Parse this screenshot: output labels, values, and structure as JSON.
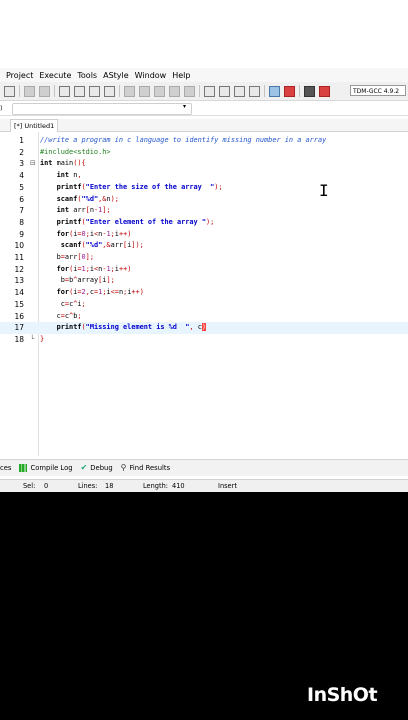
{
  "menu": {
    "items": [
      "Project",
      "Execute",
      "Tools",
      "AStyle",
      "Window",
      "Help"
    ]
  },
  "toolbar": {
    "compiler": "TDM-GCC 4.9.2"
  },
  "tab": {
    "title": "[*] Untitled1"
  },
  "editor": {
    "lines": [
      {
        "n": "1",
        "code": "//write a program in c language to identify missing number in a array"
      },
      {
        "n": "2",
        "code": "#include<stdio.h>"
      },
      {
        "n": "3",
        "code": "int main(){"
      },
      {
        "n": "4",
        "code": "    int n,"
      },
      {
        "n": "5",
        "code": "    printf(\"Enter the size of the array  \");"
      },
      {
        "n": "6",
        "code": "    scanf(\"%d\",&n);"
      },
      {
        "n": "7",
        "code": "    int arr[n-1];"
      },
      {
        "n": "8",
        "code": "    printf(\"Enter element of the array \");"
      },
      {
        "n": "9",
        "code": "    for(i=0;i<n-1;i++)"
      },
      {
        "n": "10",
        "code": "     scanf(\"%d\",&arr[i]);"
      },
      {
        "n": "11",
        "code": "    b=arr[0];"
      },
      {
        "n": "12",
        "code": "    for(i=1;i<n-1;i++)"
      },
      {
        "n": "13",
        "code": "     b=b^array[i];"
      },
      {
        "n": "14",
        "code": "    for(i=2,c=1;i<=n;i++)"
      },
      {
        "n": "15",
        "code": "     c=c^i;"
      },
      {
        "n": "16",
        "code": "    c=c^b;"
      },
      {
        "n": "17",
        "code": "    printf(\"Missing element is %d  \", c)"
      },
      {
        "n": "18",
        "code": "}"
      }
    ]
  },
  "bottom_tabs": {
    "partial": "ces",
    "compile_log": "Compile Log",
    "debug": "Debug",
    "find_results": "Find Results"
  },
  "status": {
    "sel_label": "Sel:",
    "sel": "0",
    "lines_label": "Lines:",
    "lines": "18",
    "length_label": "Length:",
    "length": "410",
    "mode": "Insert"
  },
  "watermark": "InShOt"
}
